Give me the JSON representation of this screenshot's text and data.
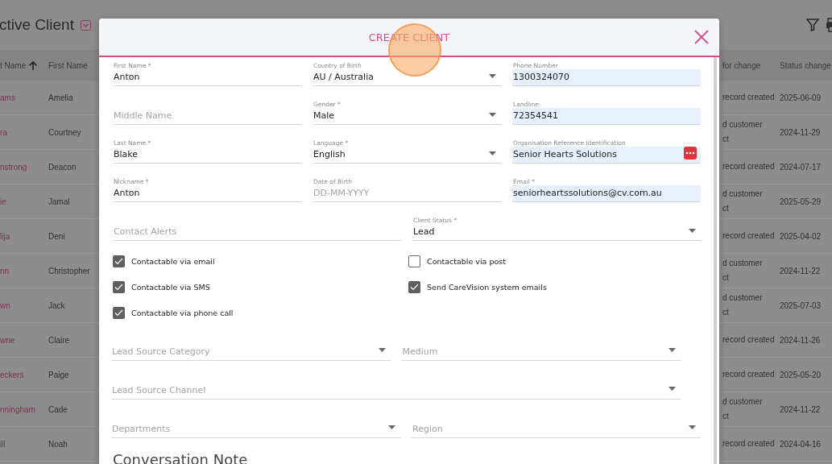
{
  "background": {
    "title": "ctive Client",
    "columns": [
      {
        "label": "t Name",
        "sorted": true
      },
      {
        "label": "First Name",
        "sorted": false
      },
      {
        "label": "for change",
        "sorted": false
      },
      {
        "label": "Status change",
        "sorted": false
      }
    ],
    "rows": [
      {
        "last_name": "ams",
        "first_name": "Amelia",
        "reason": [
          "record created"
        ],
        "date": "2025-06-09"
      },
      {
        "last_name": "ra",
        "first_name": "Courtney",
        "reason": [
          "d customer",
          "ct"
        ],
        "date": "2024-11-29"
      },
      {
        "last_name": "nstrong",
        "first_name": "Deacon",
        "reason": [
          "record created"
        ],
        "date": "2024-07-17"
      },
      {
        "last_name": "ie",
        "first_name": "Jamal",
        "reason": [
          "d customer",
          "ct"
        ],
        "date": "2025-05-29"
      },
      {
        "last_name": "lija",
        "first_name": "Deni",
        "reason": [
          "record created"
        ],
        "date": "2025-04-02"
      },
      {
        "last_name": "nn",
        "first_name": "Christopher",
        "reason": [
          "d customer",
          "ct"
        ],
        "date": "2024-11-22"
      },
      {
        "last_name": "wn",
        "first_name": "Jack",
        "reason": [
          "d customer",
          "ct"
        ],
        "date": "2025-07-03"
      },
      {
        "last_name": "wne",
        "first_name": "Claire",
        "reason": [
          "record created"
        ],
        "date": "2024-11-26"
      },
      {
        "last_name": "eckers",
        "first_name": "Paige",
        "reason": [
          "record created"
        ],
        "date": "2025-05-20"
      },
      {
        "last_name": "nningham",
        "first_name": "Cade",
        "reason": [
          "d customer",
          "ct"
        ],
        "date": "2024-11-22"
      },
      {
        "last_name": "ill",
        "first_name": "Noah",
        "reason": [
          "record created"
        ],
        "date": "2024-04-16"
      }
    ]
  },
  "modal": {
    "title": "CREATE CLIENT",
    "form_rows": [
      [
        {
          "kind": "text",
          "label": "First Name *",
          "value": "Anton",
          "autofilled": false
        },
        {
          "kind": "select",
          "label": "Country of Birth",
          "value": "AU / Australia",
          "autofilled": false
        },
        {
          "kind": "text",
          "label": "Phone Number",
          "value": "1300324070",
          "autofilled": true
        }
      ],
      [
        {
          "kind": "text",
          "placeholder": "Middle Name",
          "autofilled": false
        },
        {
          "kind": "select",
          "label": "Gender *",
          "value": "Male",
          "autofilled": false
        },
        {
          "kind": "text",
          "label": "Landline",
          "value": "72354541",
          "autofilled": true
        }
      ],
      [
        {
          "kind": "text",
          "label": "Last Name *",
          "value": "Blake",
          "autofilled": false
        },
        {
          "kind": "select",
          "label": "Language *",
          "value": "English",
          "autofilled": false
        },
        {
          "kind": "lookup",
          "label": "Organisation Reference Identification",
          "value": "Senior Hearts Solutions",
          "autofilled": true
        }
      ],
      [
        {
          "kind": "text",
          "label": "Nickname *",
          "value": "Anton",
          "autofilled": false
        },
        {
          "kind": "text",
          "label": "Date of Birth",
          "placeholder": "DD-MM-YYYY",
          "autofilled": false
        },
        {
          "kind": "text",
          "label": "Email *",
          "value": "seniorheartssolutions@cv.com.au",
          "autofilled": true
        }
      ],
      [
        {
          "kind": "text",
          "placeholder": "Contact Alerts",
          "autofilled": false
        },
        {
          "kind": "select",
          "label": "Client Status *",
          "value": "Lead",
          "autofilled": false
        }
      ]
    ],
    "checkboxes": [
      {
        "label": "Contactable via email",
        "checked": true
      },
      {
        "label": "Contactable via post",
        "checked": false
      },
      {
        "label": "Contactable via SMS",
        "checked": true
      },
      {
        "label": "Send CareVision system emails",
        "checked": true
      },
      {
        "label": "Contactable via phone call",
        "checked": true
      }
    ],
    "source_rows": [
      [
        {
          "kind": "select",
          "placeholder": "Lead Source Category",
          "autofilled": false
        },
        {
          "kind": "select",
          "placeholder": "Medium",
          "autofilled": false
        }
      ],
      [
        {
          "kind": "select",
          "placeholder": "Lead Source Channel",
          "autofilled": false
        }
      ],
      [
        {
          "kind": "select",
          "placeholder": "Departments",
          "autofilled": false
        },
        {
          "kind": "select",
          "placeholder": "Region",
          "autofilled": false
        }
      ]
    ],
    "section_heading": "Conversation Note"
  }
}
